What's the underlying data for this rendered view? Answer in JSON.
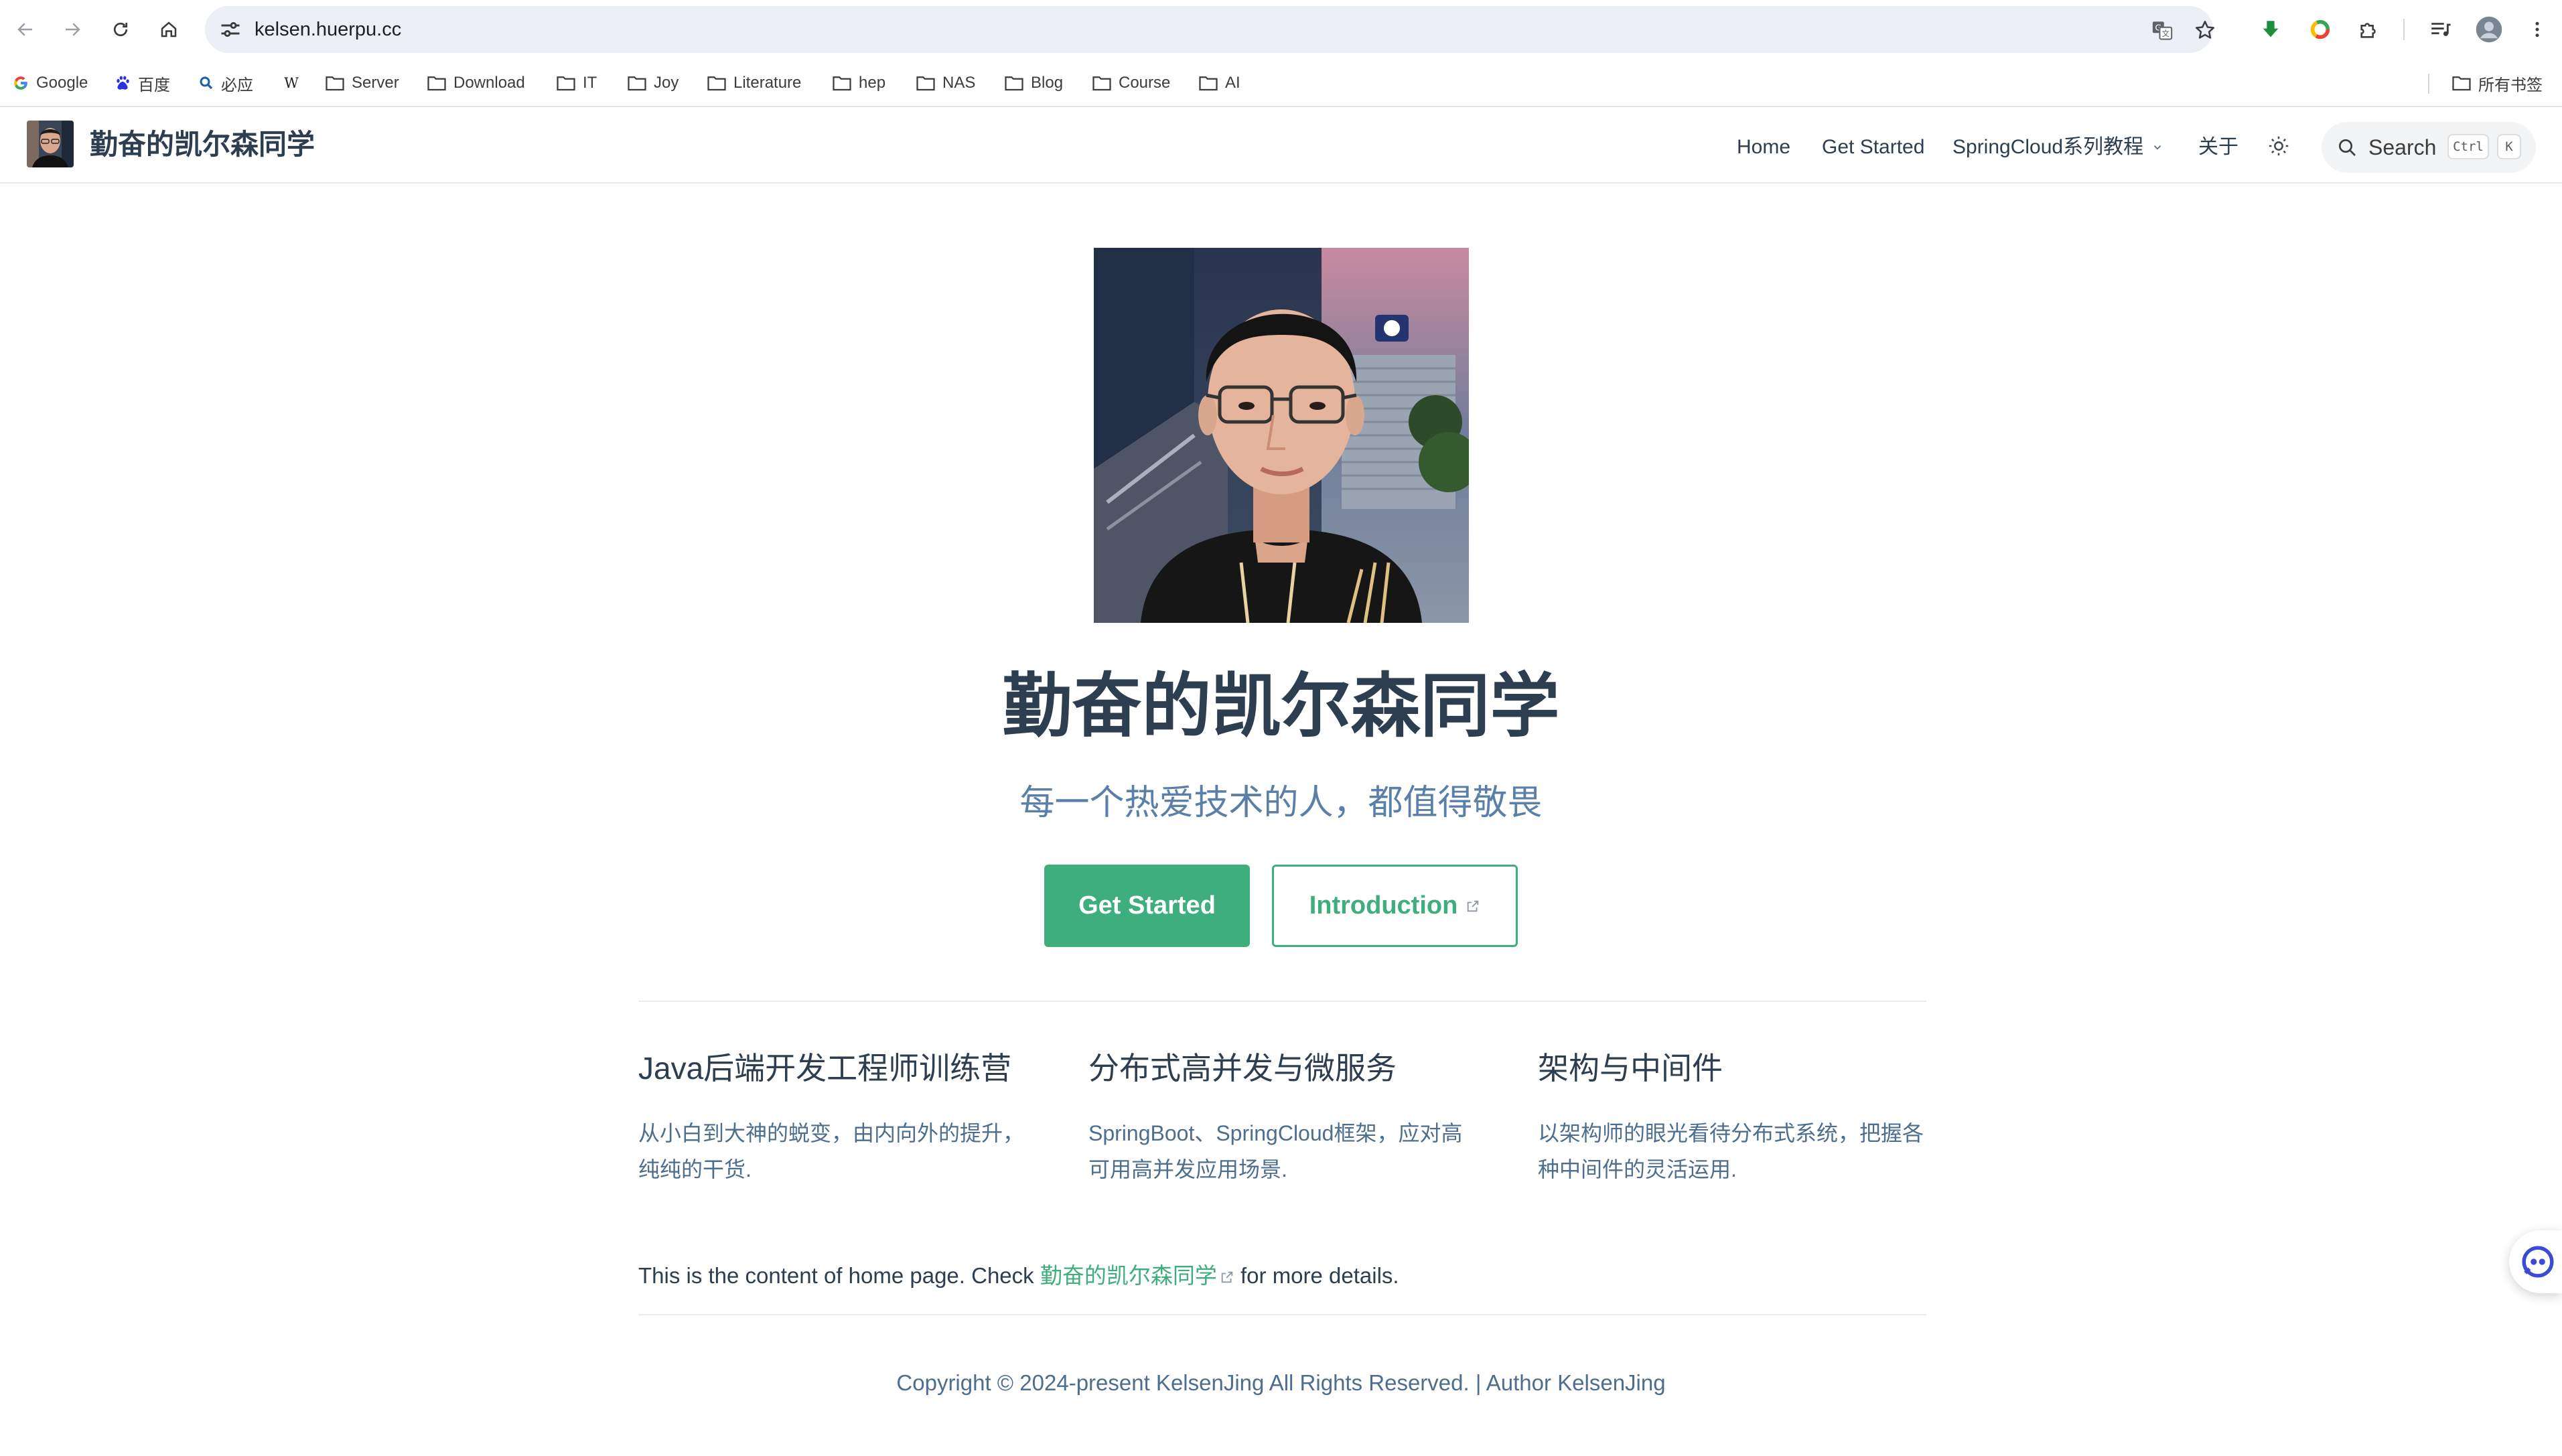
{
  "browser": {
    "url": "kelsen.huerpu.cc",
    "bookmarks": [
      {
        "label": "Google",
        "icon": "google-icon"
      },
      {
        "label": "百度",
        "icon": "baidu-icon"
      },
      {
        "label": "必应",
        "icon": "bing-icon"
      },
      {
        "label": "",
        "icon": "wikipedia-icon"
      },
      {
        "label": "Server",
        "icon": "folder-icon"
      },
      {
        "label": "Download",
        "icon": "folder-icon"
      },
      {
        "label": "IT",
        "icon": "folder-icon"
      },
      {
        "label": "Joy",
        "icon": "folder-icon"
      },
      {
        "label": "Literature",
        "icon": "folder-icon"
      },
      {
        "label": "hep",
        "icon": "folder-icon"
      },
      {
        "label": "NAS",
        "icon": "folder-icon"
      },
      {
        "label": "Blog",
        "icon": "folder-icon"
      },
      {
        "label": "Course",
        "icon": "folder-icon"
      },
      {
        "label": "AI",
        "icon": "folder-icon"
      }
    ],
    "all_bookmarks": "所有书签"
  },
  "site": {
    "title": "勤奋的凯尔森同学",
    "nav": {
      "home": "Home",
      "get_started": "Get Started",
      "springcloud": "SpringCloud系列教程",
      "about": "关于",
      "search": "Search",
      "kbd_ctrl": "Ctrl",
      "kbd_k": "K"
    }
  },
  "hero": {
    "title": "勤奋的凯尔森同学",
    "tagline": "每一个热爱技术的人，都值得敬畏",
    "primary_button": "Get Started",
    "secondary_button": "Introduction"
  },
  "features": [
    {
      "title": "Java后端开发工程师训练营",
      "details_1": "从小白到大神的蜕变，由内向外的提升，",
      "details_2": "纯纯的干货."
    },
    {
      "title": "分布式高并发与微服务",
      "details_1": "SpringBoot、SpringCloud框架，应对高",
      "details_2": "可用高并发应用场景."
    },
    {
      "title": "架构与中间件",
      "details_1": "以架构师的眼光看待分布式系统，把握各",
      "details_2": "种中间件的灵活运用."
    }
  ],
  "content": {
    "prefix": "This is the content of home page. Check ",
    "link": "勤奋的凯尔森同学",
    "suffix": " for more details."
  },
  "footer": "Copyright © 2024-present KelsenJing All Rights Reserved. | Author KelsenJing",
  "colors": {
    "accent": "#3eaf7c",
    "text": "#2c3e50",
    "muted": "#4e6e8e"
  }
}
